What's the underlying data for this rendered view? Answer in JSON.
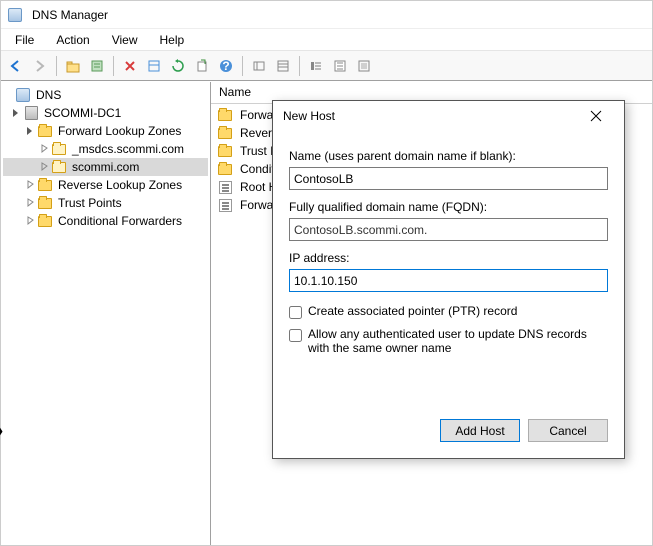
{
  "title": "DNS Manager",
  "menu": {
    "file": "File",
    "action": "Action",
    "view": "View",
    "help": "Help"
  },
  "toolbar_icons": {
    "back": "back-arrow-icon",
    "forward": "forward-arrow-icon",
    "up": "up-folder-icon",
    "props": "properties-icon",
    "delete": "delete-icon",
    "refresh": "refresh-icon",
    "export": "export-icon",
    "help": "help-icon",
    "filter": "filter-icon",
    "list1": "list-view-icon",
    "list2": "detail-view-icon",
    "list3": "column-icon"
  },
  "tree": {
    "root": "DNS",
    "server": "SCOMMI-DC1",
    "flz": "Forward Lookup Zones",
    "msdcs": "_msdcs.scommi.com",
    "scommi": "scommi.com",
    "rlz": "Reverse Lookup Zones",
    "tp": "Trust Points",
    "cf": "Conditional Forwarders"
  },
  "list_header": "Name",
  "list_rows": {
    "r0": "Forward L",
    "r1": "Reverse Lo",
    "r2": "Trust Poin",
    "r3": "Condition",
    "r4": "Root Hint",
    "r5": "Forwarder"
  },
  "dialog": {
    "title": "New Host",
    "label_name": "Name (uses parent domain name if blank):",
    "val_name": "ContosoLB",
    "label_fqdn": "Fully qualified domain name (FQDN):",
    "val_fqdn": "ContosoLB.scommi.com.",
    "label_ip": "IP address:",
    "val_ip": "10.1.10.150",
    "check_ptr": "Create associated pointer (PTR) record",
    "check_auth": "Allow any authenticated user to update DNS records with the same owner name",
    "ptr_checked": false,
    "auth_checked": false,
    "btn_add": "Add Host",
    "btn_cancel": "Cancel"
  }
}
